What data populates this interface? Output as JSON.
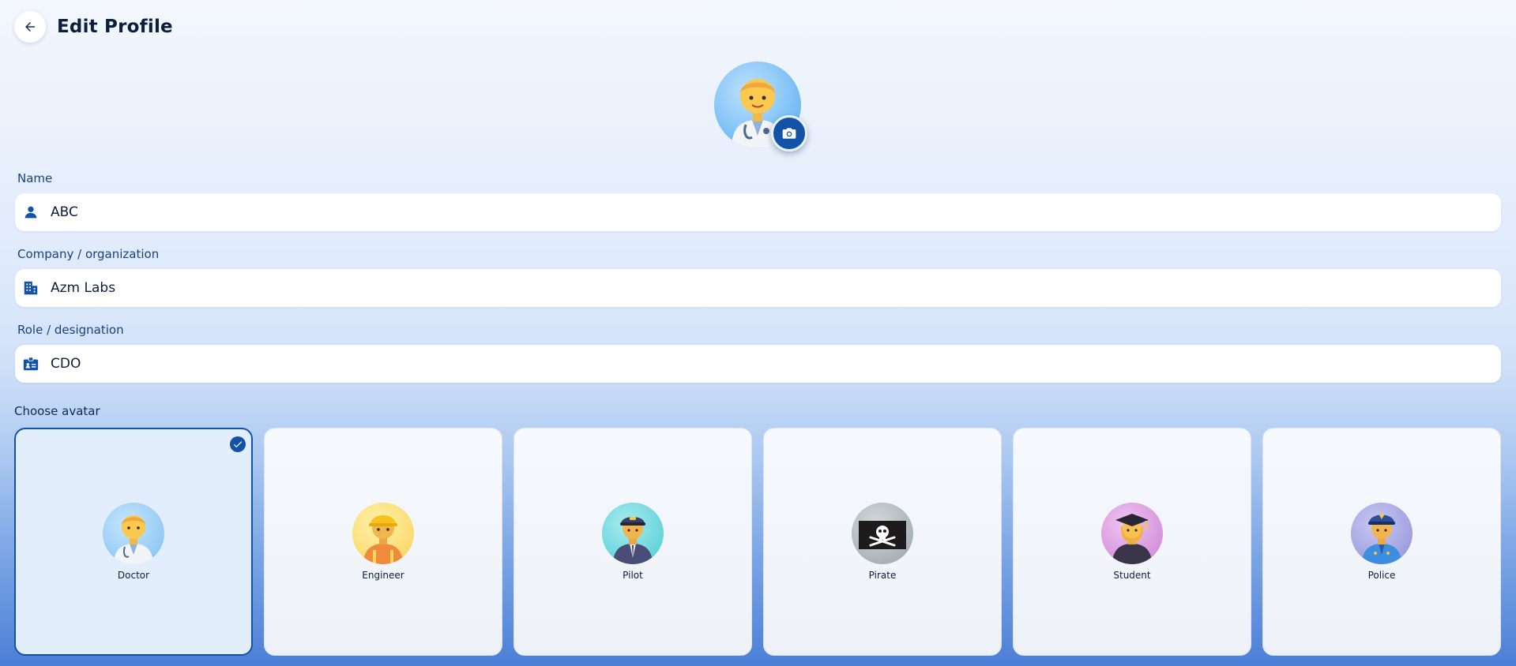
{
  "header": {
    "title": "Edit Profile",
    "back_icon": "arrow-left-icon"
  },
  "profile": {
    "avatar": "doctor",
    "camera_icon": "camera-icon"
  },
  "form": {
    "name": {
      "label": "Name",
      "value": "ABC",
      "icon": "person-icon"
    },
    "company": {
      "label": "Company / organization",
      "value": "Azm Labs",
      "icon": "building-icon"
    },
    "role": {
      "label": "Role / designation",
      "value": "CDO",
      "icon": "badge-icon"
    }
  },
  "avatars": {
    "label": "Choose avatar",
    "selected": "Doctor",
    "items": [
      {
        "label": "Doctor",
        "bg": "#8ec8f2"
      },
      {
        "label": "Engineer",
        "bg": "#fde27a"
      },
      {
        "label": "Pilot",
        "bg": "#6fd3da"
      },
      {
        "label": "Pirate",
        "bg": "#aab4b8"
      },
      {
        "label": "Student",
        "bg": "#d99be0"
      },
      {
        "label": "Police",
        "bg": "#a8a9e6"
      }
    ]
  },
  "colors": {
    "accent": "#1452a8",
    "label": "#17427f",
    "text": "#0b1e3d"
  }
}
